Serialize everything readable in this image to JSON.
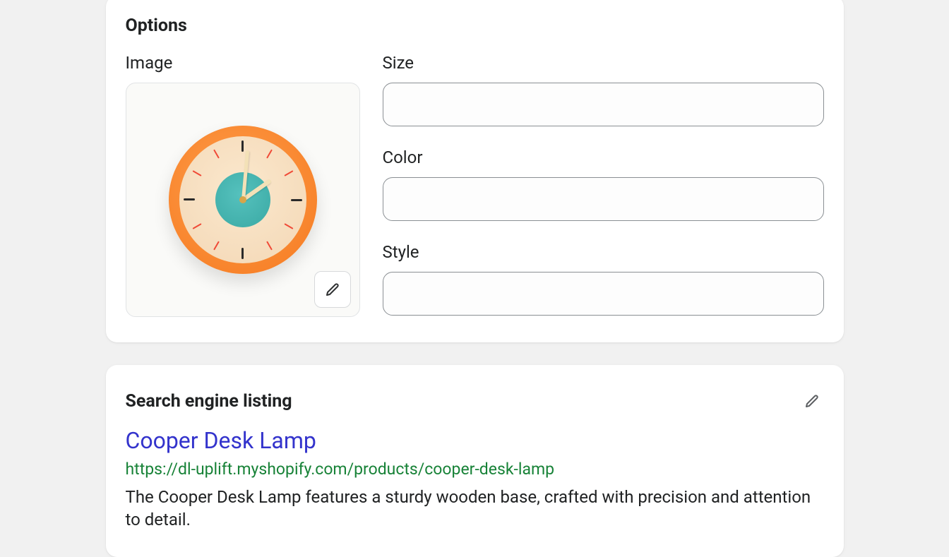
{
  "options": {
    "heading": "Options",
    "image_label": "Image",
    "fields": {
      "size": {
        "label": "Size",
        "value": ""
      },
      "color": {
        "label": "Color",
        "value": ""
      },
      "style": {
        "label": "Style",
        "value": ""
      }
    }
  },
  "seo": {
    "heading": "Search engine listing",
    "title": "Cooper Desk Lamp",
    "url": "https://dl-uplift.myshopify.com/products/cooper-desk-lamp",
    "description": "The Cooper Desk Lamp features a sturdy wooden base, crafted with precision and attention to detail."
  }
}
